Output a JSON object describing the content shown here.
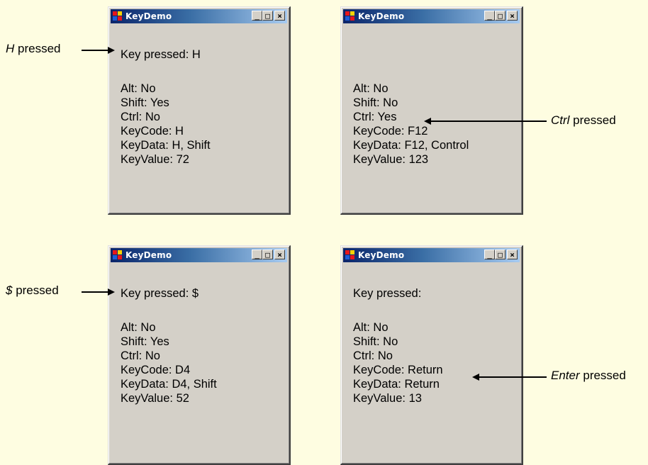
{
  "windows": [
    {
      "title": "KeyDemo",
      "key_pressed": "Key pressed: H",
      "alt": "Alt: No",
      "shift": "Shift: Yes",
      "ctrl": "Ctrl: No",
      "keycode": "KeyCode: H",
      "keydata": "KeyData: H, Shift",
      "keyvalue": "KeyValue: 72"
    },
    {
      "title": "KeyDemo",
      "key_pressed": "",
      "alt": "Alt: No",
      "shift": "Shift: No",
      "ctrl": "Ctrl: Yes",
      "keycode": "KeyCode: F12",
      "keydata": "KeyData: F12, Control",
      "keyvalue": "KeyValue: 123"
    },
    {
      "title": "KeyDemo",
      "key_pressed": "Key pressed: $",
      "alt": "Alt: No",
      "shift": "Shift: Yes",
      "ctrl": "Ctrl: No",
      "keycode": "KeyCode: D4",
      "keydata": "KeyData: D4, Shift",
      "keyvalue": "KeyValue: 52"
    },
    {
      "title": "KeyDemo",
      "key_pressed": "Key pressed:",
      "alt": "Alt: No",
      "shift": "Shift: No",
      "ctrl": "Ctrl: No",
      "keycode": "KeyCode: Return",
      "keydata": "KeyData: Return",
      "keyvalue": "KeyValue: 13"
    }
  ],
  "annotations": [
    {
      "key": "H",
      "rest": " pressed"
    },
    {
      "key": "Ctrl",
      "rest": " pressed"
    },
    {
      "key": "$",
      "rest": " pressed"
    },
    {
      "key": "Enter",
      "rest": " pressed"
    }
  ],
  "titlebar_buttons": {
    "minimize": "_",
    "maximize": "□",
    "close": "×"
  },
  "colors": {
    "page_background": "#fefde1",
    "window_face": "#d4d0c8",
    "titlebar_start": "#0a246a",
    "titlebar_end": "#a6caf0"
  }
}
